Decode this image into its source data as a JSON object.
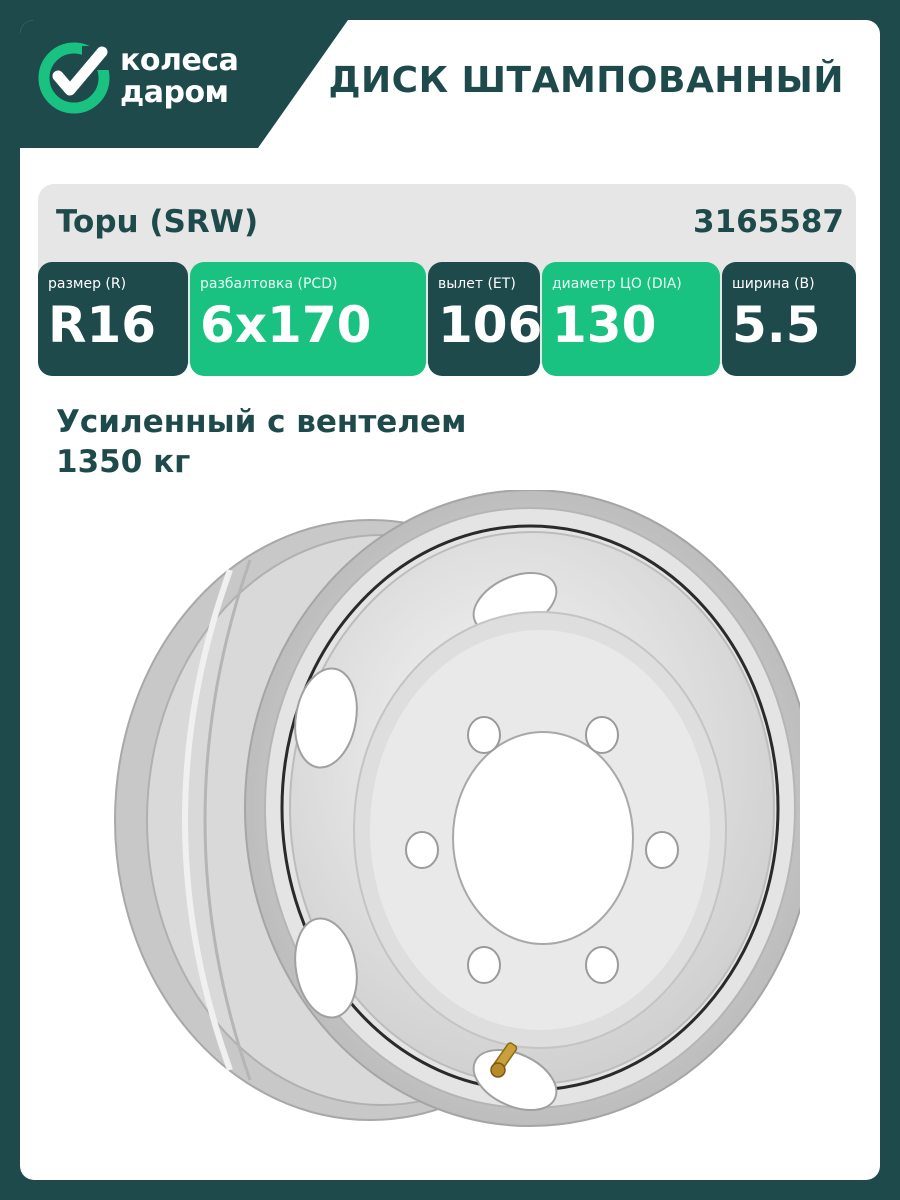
{
  "brand": {
    "logo_line1": "колеса",
    "logo_line2": "даром",
    "logo_icon": "checkmark-circle-icon"
  },
  "header": {
    "title": "ДИСК ШТАМПОВАННЫЙ"
  },
  "product": {
    "name": "Topu (SRW)",
    "sku": "3165587"
  },
  "specs": [
    {
      "label": "размер (R)",
      "value": "R16"
    },
    {
      "label": "разбалтовка (PCD)",
      "value": "6x170"
    },
    {
      "label": "вылет (ET)",
      "value": "106"
    },
    {
      "label": "диаметр ЦО (DIA)",
      "value": "130"
    },
    {
      "label": "ширина (B)",
      "value": "5.5"
    }
  ],
  "description": {
    "line1": "Усиленный с вентелем",
    "line2": "1350 кг"
  },
  "colors": {
    "dark_teal": "#1e4a4c",
    "green": "#1ac282",
    "panel_gray": "#e6e6e6"
  }
}
